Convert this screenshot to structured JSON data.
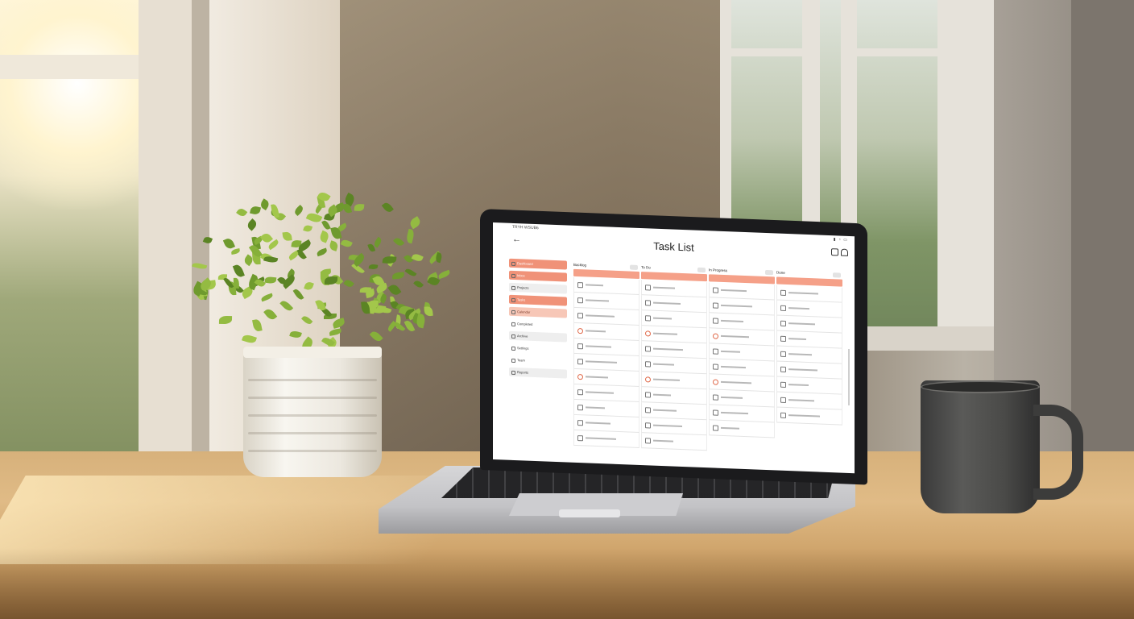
{
  "app": {
    "title": "Task List",
    "status_left": "TRYH WSUB6",
    "status_icons": "▮ ◔ ▭",
    "icons": [
      "back-arrow-icon",
      "share-icon",
      "notification-icon"
    ]
  },
  "sidebar": {
    "items": [
      {
        "label": "Dashboard",
        "style": "accent"
      },
      {
        "label": "Inbox",
        "style": "accent"
      },
      {
        "label": "Projects",
        "style": "grey"
      },
      {
        "label": "Tasks",
        "style": "accent"
      },
      {
        "label": "Calendar",
        "style": "soft"
      },
      {
        "label": "Completed",
        "style": "plain"
      },
      {
        "label": "Archive",
        "style": "grey"
      },
      {
        "label": "Settings",
        "style": "plain"
      },
      {
        "label": "Team",
        "style": "plain"
      },
      {
        "label": "Reports",
        "style": "grey"
      }
    ]
  },
  "board": {
    "columns": [
      {
        "title": "Backlog",
        "tasks": 11
      },
      {
        "title": "To Do",
        "tasks": 11
      },
      {
        "title": "In Progress",
        "tasks": 10
      },
      {
        "title": "Done",
        "tasks": 9
      }
    ]
  },
  "colors": {
    "accent": "#f09278",
    "accent_soft": "#f7c7b7",
    "band": "#f5a088",
    "flag": "#e06848"
  }
}
